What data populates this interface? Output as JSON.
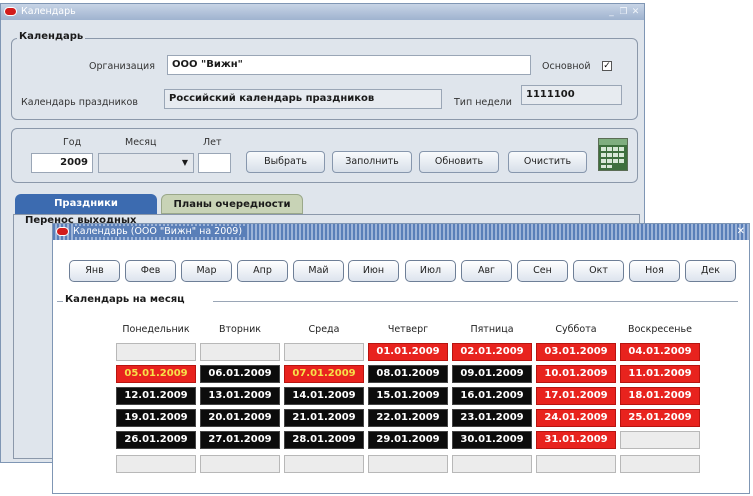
{
  "main_window": {
    "title": "Календарь",
    "controls": [
      "_",
      "❐",
      "✕"
    ],
    "section_calendar": {
      "legend": "Календарь",
      "org_label": "Организация",
      "org_value": "ООО \"Вижн\"",
      "main_label": "Основной",
      "main_checked": true,
      "holidays_label": "Календарь праздников",
      "holidays_value": "Российский календарь праздников",
      "week_type_label": "Тип недели",
      "week_type_value": "1111100"
    },
    "section_filter": {
      "year_label": "Год",
      "year_value": "2009",
      "month_label": "Месяц",
      "month_value": "",
      "years_label": "Лет",
      "years_value": "",
      "buttons": [
        "Выбрать",
        "Заполнить",
        "Обновить",
        "Очистить"
      ]
    },
    "tabs": [
      "Праздники",
      "Планы очередности"
    ],
    "partial_legend": "Перенос выходных"
  },
  "dialog": {
    "title": "Календарь (ООО \"Вижн\" на 2009)",
    "close": "✕",
    "months": [
      "Янв",
      "Фев",
      "Мар",
      "Апр",
      "Май",
      "Июн",
      "Июл",
      "Авг",
      "Сен",
      "Окт",
      "Ноя",
      "Дек"
    ],
    "section_title": "Календарь на месяц",
    "weekdays": [
      "Понедельник",
      "Вторник",
      "Среда",
      "Четверг",
      "Пятница",
      "Суббота",
      "Воскресенье"
    ],
    "weeks": [
      [
        {
          "t": "",
          "s": "empty"
        },
        {
          "t": "",
          "s": "empty"
        },
        {
          "t": "",
          "s": "empty"
        },
        {
          "t": "01.01.2009",
          "s": "hol"
        },
        {
          "t": "02.01.2009",
          "s": "hol"
        },
        {
          "t": "03.01.2009",
          "s": "hol"
        },
        {
          "t": "04.01.2009",
          "s": "hol"
        }
      ],
      [
        {
          "t": "05.01.2009",
          "s": "cur"
        },
        {
          "t": "06.01.2009",
          "s": "work"
        },
        {
          "t": "07.01.2009",
          "s": "cur"
        },
        {
          "t": "08.01.2009",
          "s": "work"
        },
        {
          "t": "09.01.2009",
          "s": "work"
        },
        {
          "t": "10.01.2009",
          "s": "hol"
        },
        {
          "t": "11.01.2009",
          "s": "hol"
        }
      ],
      [
        {
          "t": "12.01.2009",
          "s": "work"
        },
        {
          "t": "13.01.2009",
          "s": "work"
        },
        {
          "t": "14.01.2009",
          "s": "work"
        },
        {
          "t": "15.01.2009",
          "s": "work"
        },
        {
          "t": "16.01.2009",
          "s": "work"
        },
        {
          "t": "17.01.2009",
          "s": "hol"
        },
        {
          "t": "18.01.2009",
          "s": "hol"
        }
      ],
      [
        {
          "t": "19.01.2009",
          "s": "work"
        },
        {
          "t": "20.01.2009",
          "s": "work"
        },
        {
          "t": "21.01.2009",
          "s": "work"
        },
        {
          "t": "22.01.2009",
          "s": "work"
        },
        {
          "t": "23.01.2009",
          "s": "work"
        },
        {
          "t": "24.01.2009",
          "s": "hol"
        },
        {
          "t": "25.01.2009",
          "s": "hol"
        }
      ],
      [
        {
          "t": "26.01.2009",
          "s": "work"
        },
        {
          "t": "27.01.2009",
          "s": "work"
        },
        {
          "t": "28.01.2009",
          "s": "work"
        },
        {
          "t": "29.01.2009",
          "s": "work"
        },
        {
          "t": "30.01.2009",
          "s": "work"
        },
        {
          "t": "31.01.2009",
          "s": "hol"
        },
        {
          "t": "",
          "s": "empty"
        }
      ],
      [
        {
          "t": "",
          "s": "empty"
        },
        {
          "t": "",
          "s": "empty"
        },
        {
          "t": "",
          "s": "empty"
        },
        {
          "t": "",
          "s": "empty"
        },
        {
          "t": "",
          "s": "empty"
        },
        {
          "t": "",
          "s": "empty"
        },
        {
          "t": "",
          "s": "empty"
        }
      ]
    ]
  }
}
